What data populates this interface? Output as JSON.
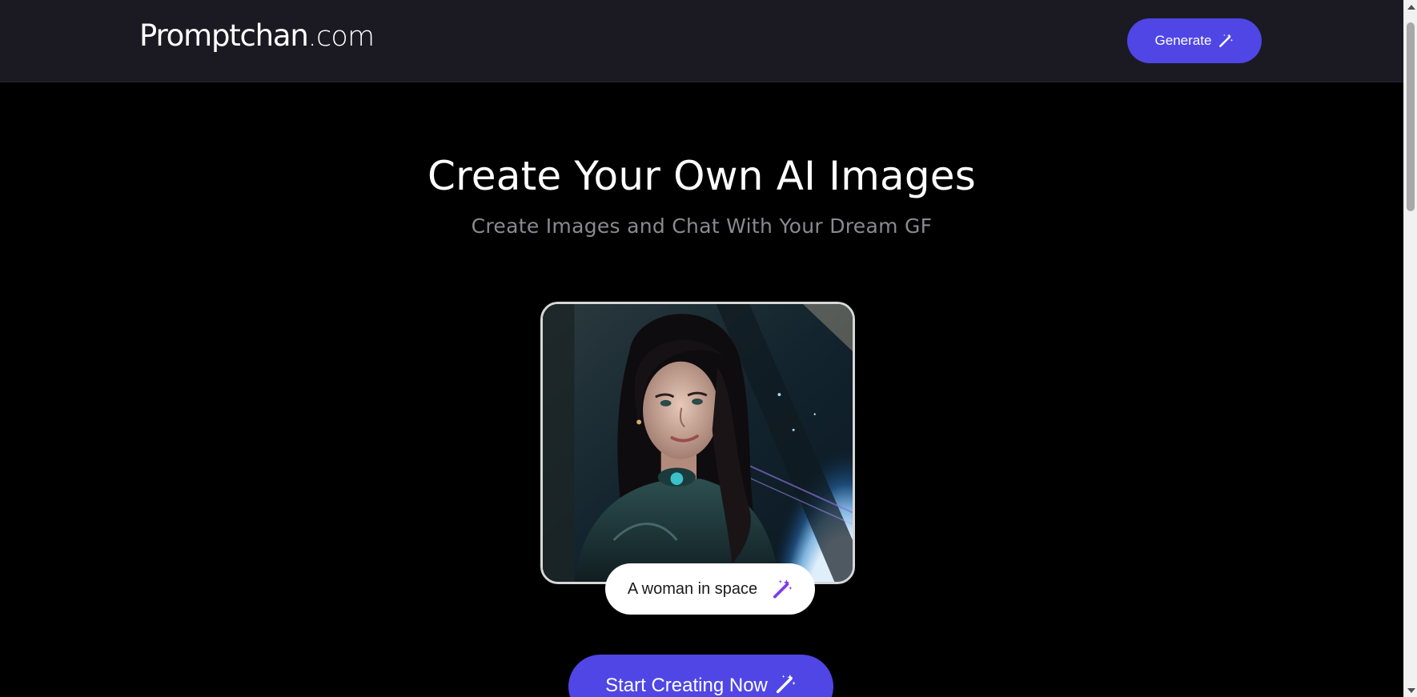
{
  "header": {
    "logo_main": "Promptchan",
    "logo_tld": ".com",
    "generate_label": "Generate"
  },
  "hero": {
    "title": "Create Your Own AI Images",
    "subtitle": "Create Images and Chat With Your Dream GF"
  },
  "showcase": {
    "prompt_text": "A woman in space",
    "prompt_icon": "magic-wand-icon"
  },
  "cta": {
    "label": "Start Creating Now",
    "icon": "magic-wand-icon"
  },
  "colors": {
    "accent": "#4f46e5",
    "navbar_bg": "#1b1a23",
    "page_bg": "#000000",
    "subtitle": "#8a8a8e",
    "prompt_icon": "#7c3aed"
  }
}
